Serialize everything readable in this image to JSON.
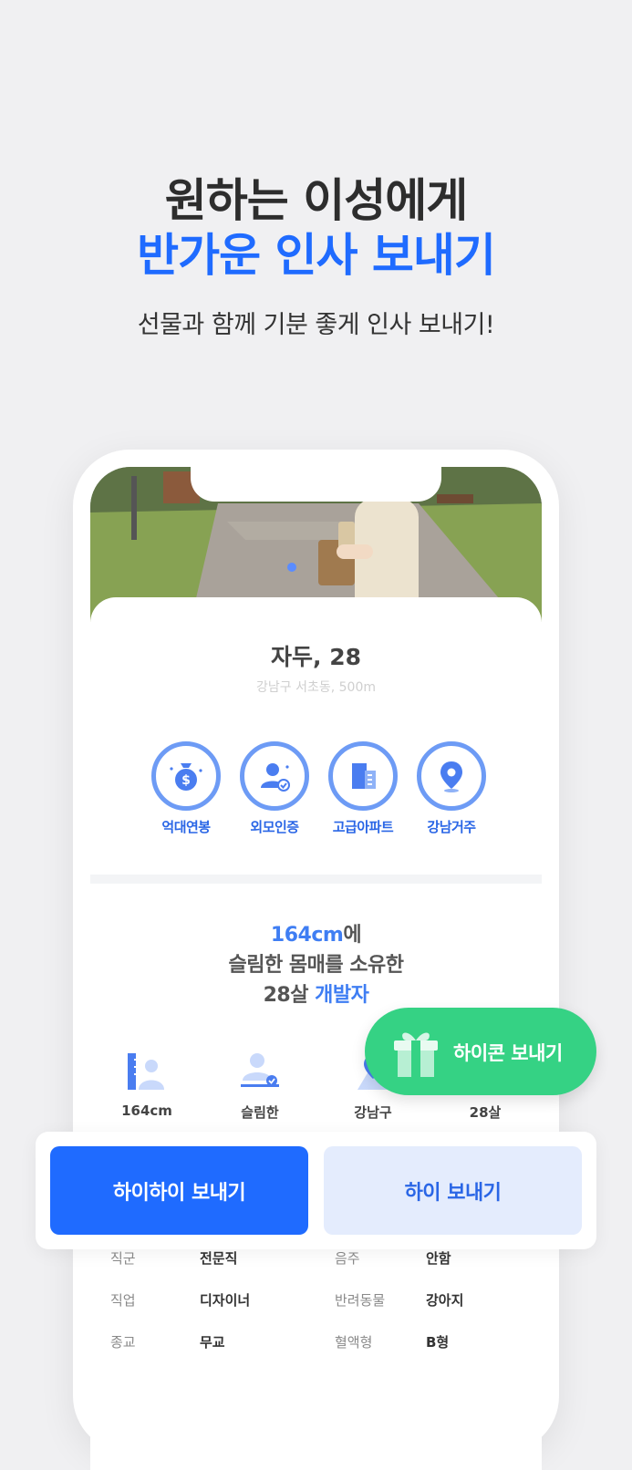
{
  "hero": {
    "title_line1": "원하는 이성에게",
    "title_line2": "반가운 인사 보내기",
    "subtitle": "선물과 함께 기분 좋게 인사 보내기!"
  },
  "profile": {
    "name_age": "자두, 28",
    "location": "강남구 서초동, 500m",
    "photo_page_index": 1,
    "badges": [
      {
        "label": "억대연봉",
        "icon": "money-bag-icon"
      },
      {
        "label": "외모인증",
        "icon": "verified-person-icon"
      },
      {
        "label": "고급아파트",
        "icon": "apartment-icon"
      },
      {
        "label": "강남거주",
        "icon": "location-pin-icon"
      }
    ],
    "description": {
      "height": "164cm",
      "height_suffix": "에",
      "line2": "슬림한 몸매를 소유한",
      "age": "28살",
      "job": "개발자"
    },
    "stats": [
      {
        "label": "164cm",
        "icon": "height-ruler-icon"
      },
      {
        "label": "슬림한",
        "icon": "body-slim-icon"
      },
      {
        "label": "강남구",
        "icon": "location-icon"
      },
      {
        "label": "28살",
        "icon": "age-icon"
      }
    ],
    "info": [
      {
        "label": "직군",
        "value": "전문직",
        "label2": "음주",
        "value2": "안함"
      },
      {
        "label": "직업",
        "value": "디자이너",
        "label2": "반려동물",
        "value2": "강아지"
      },
      {
        "label": "종교",
        "value": "무교",
        "label2": "혈액형",
        "value2": "B형"
      }
    ]
  },
  "gift_button": {
    "label": "하이콘 보내기",
    "icon": "gift-icon"
  },
  "actions": {
    "primary": "하이하이 보내기",
    "secondary": "하이 보내기"
  },
  "colors": {
    "brand_blue": "#1f6bff",
    "gift_green": "#35d284",
    "badge_ring": "#6d9bf5"
  }
}
